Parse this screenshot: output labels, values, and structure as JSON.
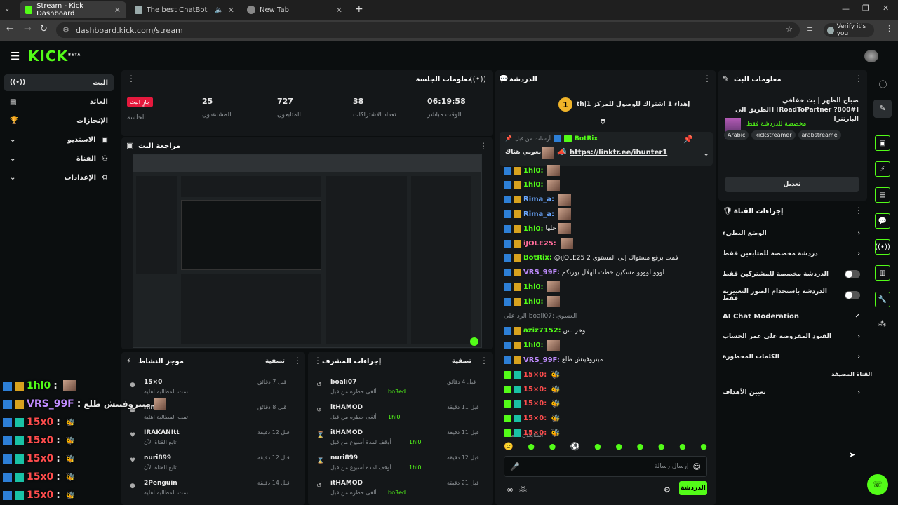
{
  "browser": {
    "tabs": [
      {
        "title": "Stream - Kick Dashboard"
      },
      {
        "title": "The best ChatBot and Widg"
      },
      {
        "title": "New Tab"
      }
    ],
    "url": "dashboard.kick.com/stream",
    "profile_label": "Verify it's you"
  },
  "brand": {
    "logo": "KICK",
    "beta": "BETA",
    "accent": "#53fc18"
  },
  "sidebar": {
    "items": [
      {
        "label": "البث"
      },
      {
        "label": "العائد"
      },
      {
        "label": "الإنجازات"
      },
      {
        "label": "الاستديو"
      },
      {
        "label": "القناة"
      },
      {
        "label": "الإعدادات"
      }
    ]
  },
  "session": {
    "title": "معلومات الجلسة",
    "live_badge": "جارٍ البث",
    "session_label": "الجلسة",
    "stats": [
      {
        "value": "25",
        "label": "المشاهدون"
      },
      {
        "value": "727",
        "label": "المتابعون"
      },
      {
        "value": "38",
        "label": "تعداد الاشتراكات"
      },
      {
        "value": "06:19:58",
        "label": "الوقت مباشر"
      }
    ]
  },
  "preview": {
    "title": "مراجعة البث"
  },
  "chat": {
    "title": "الدردشة",
    "goal_rank": "1",
    "goal_text": "th|إهداء 1 اشتراك للوصول للمركز 1",
    "pinned_by": "أرسلت من قبل",
    "pinned_user": "BotRix",
    "pinned_text": "تابعوني هناك",
    "pinned_link": "https://linktr.ee/ihunter1",
    "followers_only": "المتابعون فقط",
    "input_placeholder": "إرسال رسالة",
    "send_label": "الدردشة",
    "messages": [
      {
        "user": "1hl0:",
        "text": ""
      },
      {
        "user": "1hl0:",
        "text": ""
      },
      {
        "user": "Rima_a:",
        "text": ""
      },
      {
        "user": "Rima_a:",
        "text": ""
      },
      {
        "user": "1hl0:",
        "text": "خلها"
      },
      {
        "user": "iJOLE25:",
        "text": ""
      },
      {
        "user": "BotRix:",
        "text": "@iJOLE25 2 فمت برفع مستواك إلى المستوى"
      },
      {
        "user": "VRS_99F:",
        "text": "لووو لوووو مسكين حظت الهلال يورنكم"
      },
      {
        "user": "1hl0:",
        "text": ""
      },
      {
        "user": "1hl0:",
        "text": ""
      },
      {
        "user": "",
        "text": "الرد على boali07: العسوي"
      },
      {
        "user": "aziz7152:",
        "text": "وخر بس"
      },
      {
        "user": "1hl0:",
        "text": ""
      },
      {
        "user": "VRS_99F:",
        "text": "ميتروفيتش طلع"
      },
      {
        "user": "15×0:",
        "text": ""
      },
      {
        "user": "15×0:",
        "text": ""
      },
      {
        "user": "15×0:",
        "text": ""
      },
      {
        "user": "15×0:",
        "text": ""
      },
      {
        "user": "15×0:",
        "text": ""
      }
    ]
  },
  "stream_info": {
    "title": "معلومات البث",
    "stream_title": "صباح الظهر | بث خفافي [#RoadToPartner ?800] [الطريق الى البارتنر]",
    "category": "مخصصة للدردشة فقط",
    "tags": [
      "arabstreame",
      "kickstreamer",
      "Arabic"
    ],
    "edit_label": "تعديل"
  },
  "channel_actions": {
    "title": "إجراءات القناة",
    "items": [
      {
        "label": "الوضع البطيء"
      },
      {
        "label": "دردشة مخصصة للمتابعين فقط"
      },
      {
        "label": "الدردشة مخصصة للمشتركين فقط"
      },
      {
        "label": "الدردشة باستخدام الصور التعبيرية فقط"
      },
      {
        "label": "AI Chat Moderation"
      },
      {
        "label": "القيود المفروضة على عمر الحساب"
      },
      {
        "label": "الكلمات المحظورة"
      }
    ],
    "section_label": "القناة المضيفة",
    "host_label": "تعيين الأهداف"
  },
  "activity": {
    "title": "موجز النشاط",
    "filter": "تصفية",
    "items": [
      {
        "user": "15×0",
        "desc": "تمت المطالبة اهلية",
        "time": "قبل 7 دقائق"
      },
      {
        "user": "ninjen",
        "desc": "تمت المطالبة اهلية",
        "time": "قبل 8 دقائق"
      },
      {
        "user": "IRAKANItt",
        "desc": "تابع القناة الآن",
        "time": "قبل 12 دقيقة"
      },
      {
        "user": "nuri899",
        "desc": "تابع القناة الآن",
        "time": "قبل 12 دقيقة"
      },
      {
        "user": "2Penguin",
        "desc": "تمت المطالبة اهلية",
        "time": "قبل 14 دقيقة"
      }
    ]
  },
  "mod_actions": {
    "title": "إجراءات المشرف",
    "filter": "تصفية",
    "items": [
      {
        "user": "boali07",
        "desc": "ألغى حظره من قبل",
        "by": "bo3ed",
        "time": "قبل 4 دقائق"
      },
      {
        "user": "itHAMOD",
        "desc": "ألغى حظره من قبل",
        "by": "1hl0",
        "time": "قبل 11 دقيقة"
      },
      {
        "user": "itHAMOD",
        "desc": "أوقف لمدة أسبوع من قبل",
        "by": "1hl0",
        "time": "قبل 11 دقيقة"
      },
      {
        "user": "nuri899",
        "desc": "أوقف لمدة أسبوع من قبل",
        "by": "1hl0",
        "time": "قبل 12 دقيقة"
      },
      {
        "user": "itHAMOD",
        "desc": "ألغى حظره من قبل",
        "by": "bo3ed",
        "time": "قبل 21 دقيقة"
      }
    ]
  },
  "overlay_chat": [
    {
      "user": "1hl0",
      "text": ""
    },
    {
      "user": "VRS_99F",
      "text": "ميتروفيتش طلع"
    },
    {
      "user": "15x0",
      "text": ""
    },
    {
      "user": "15x0",
      "text": ""
    },
    {
      "user": "15x0",
      "text": ""
    },
    {
      "user": "15x0",
      "text": ""
    },
    {
      "user": "15x0",
      "text": ""
    }
  ]
}
